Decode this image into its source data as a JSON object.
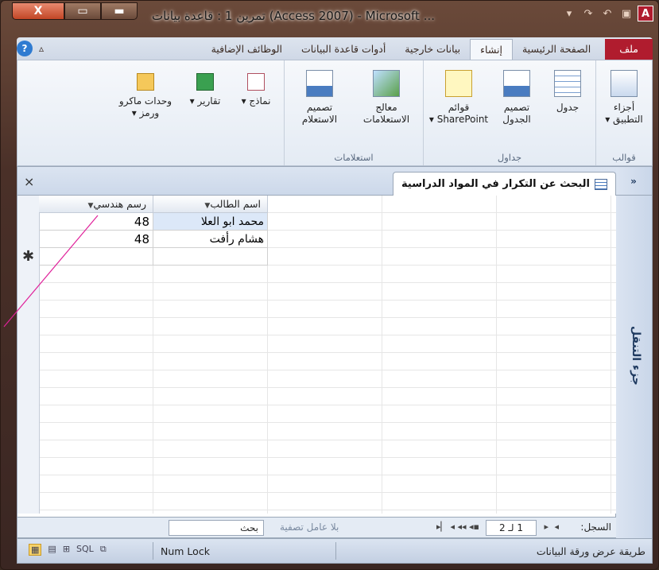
{
  "window": {
    "title": "تمرين 1 : قاعدة بيانات (Access 2007) - Microsoft ...",
    "close_glyph": "X",
    "app_letter": "A"
  },
  "ribbon_tabs": [
    {
      "label": "ملف"
    },
    {
      "label": "الصفحة الرئيسية"
    },
    {
      "label": "إنشاء"
    },
    {
      "label": "بيانات خارجية"
    },
    {
      "label": "أدوات قاعدة البيانات"
    },
    {
      "label": "الوظائف الإضافية"
    }
  ],
  "help_glyph": "?",
  "ribbon_groups": {
    "templates": {
      "label": "قوالب",
      "button": "أجزاء التطبيق ▾"
    },
    "tables": {
      "label": "جداول",
      "buttons": [
        "جدول",
        "تصميم الجدول",
        "قوائم SharePoint ▾"
      ]
    },
    "queries": {
      "label": "استعلامات",
      "buttons": [
        "معالج الاستعلامات",
        "تصميم الاستعلام"
      ]
    },
    "other": {
      "buttons": [
        "نماذج ▾",
        "تقارير ▾",
        "وحدات ماكرو ورمز ▾"
      ]
    }
  },
  "document": {
    "tab_title": "البحث عن التكرار في المواد الدراسية",
    "close_glyph": "×"
  },
  "nav_pane": {
    "toggle": "»",
    "title": "جزء التنقل"
  },
  "datasheet": {
    "columns": [
      "اسم الطالب",
      "رسم هندسي"
    ],
    "rows": [
      {
        "name": "محمد ابو العلا",
        "score": "48"
      },
      {
        "name": "هشام رأفت",
        "score": "48"
      }
    ],
    "new_row_mark": "✱"
  },
  "record_nav": {
    "label": "السجل:",
    "position": "1 لـ 2",
    "filter": "بلا عامل تصفية",
    "search": "بحث"
  },
  "status_bar": {
    "view_name": "طريقة عرض ورقة البيانات",
    "numlock": "Num Lock",
    "views": [
      "▦",
      "▤",
      "⊞",
      "SQL",
      "⧉"
    ]
  }
}
